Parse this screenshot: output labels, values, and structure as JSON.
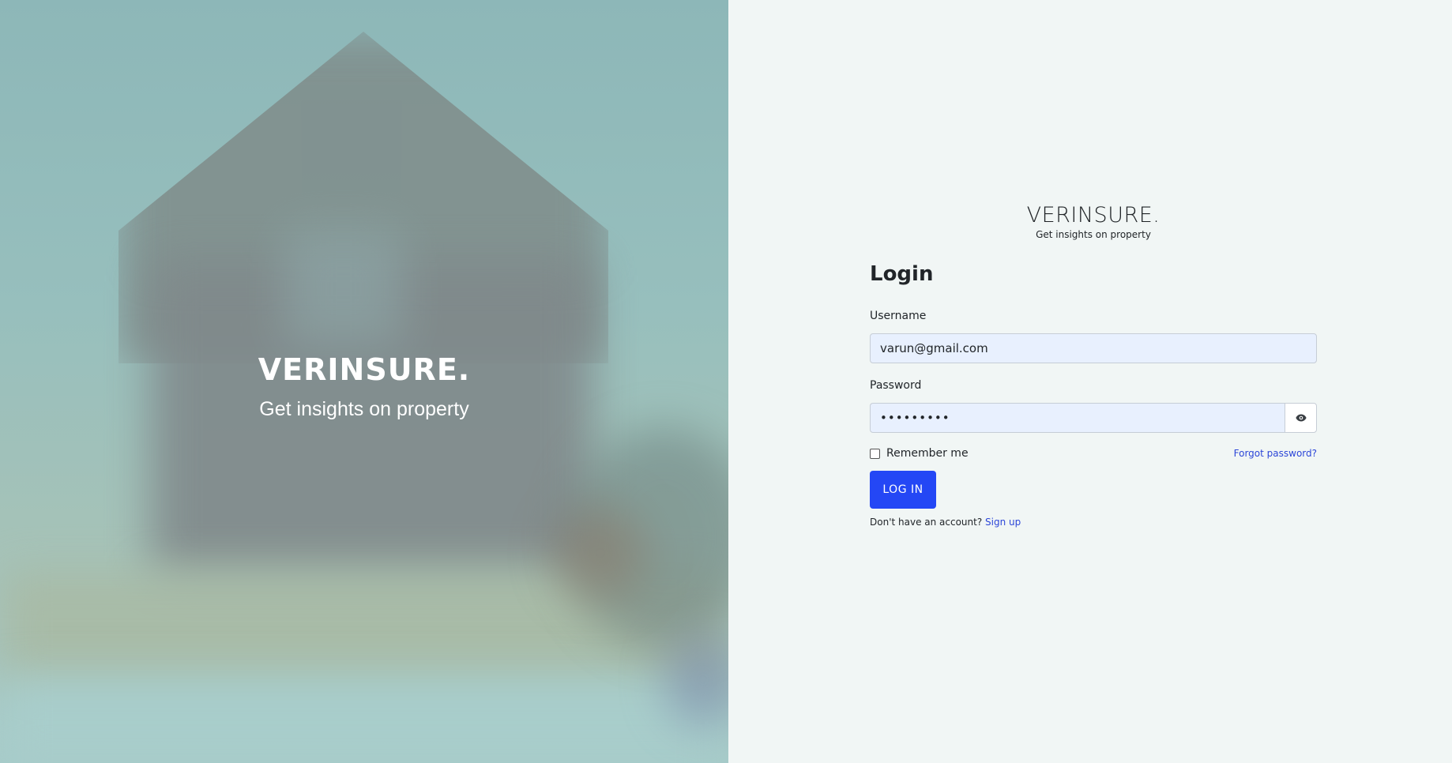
{
  "hero": {
    "brand": "VERINSURE.",
    "tagline": "Get insights on property"
  },
  "login": {
    "brand_title": "VERINSURE.",
    "brand_tagline": "Get insights on property",
    "heading": "Login",
    "username_label": "Username",
    "username_value": "varun@gmail.com",
    "password_label": "Password",
    "password_value": "•••••••••",
    "remember_label": "Remember me",
    "remember_checked": false,
    "forgot_label": "Forgot password?",
    "submit_label": "LOG IN",
    "signup_prompt": "Don't have an account?",
    "signup_label": "Sign up",
    "toggle_icon": "eye-icon"
  },
  "colors": {
    "accent": "#2447f5",
    "link": "#2c46d8",
    "panel_bg": "#f1f6f5",
    "input_bg": "#e8f0fe"
  }
}
